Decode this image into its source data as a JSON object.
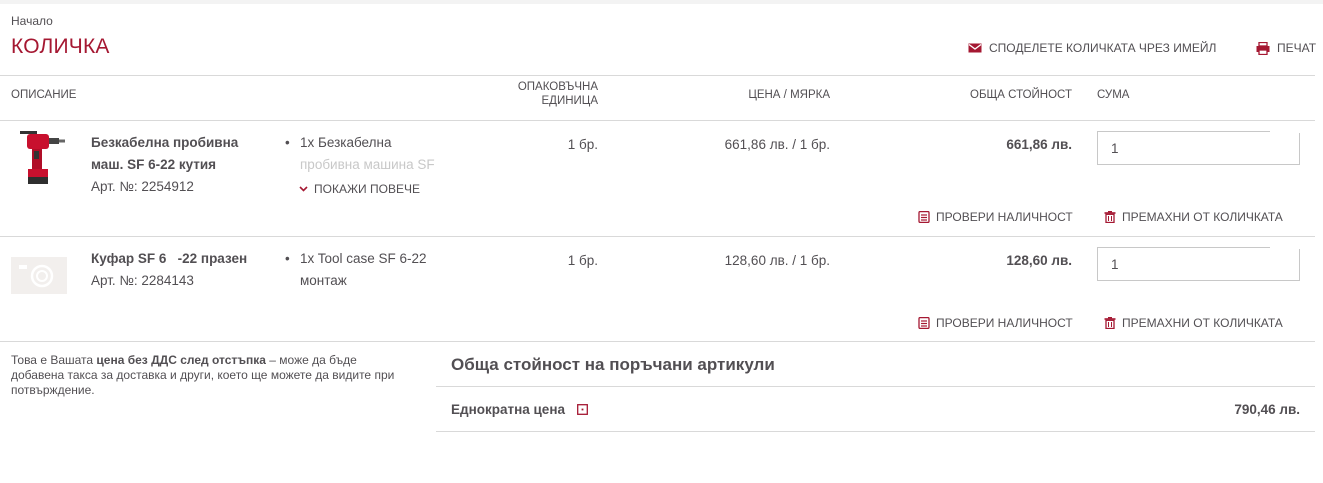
{
  "breadcrumb": "Начало",
  "title": "КОЛИЧКА",
  "actions": {
    "share_email": "СПОДЕЛЕТЕ КОЛИЧКАТА ЧРЕЗ ИМЕЙЛ",
    "print": "ПЕЧАТ"
  },
  "columns": {
    "description": "ОПИСАНИЕ",
    "pack_unit_line1": "ОПАКОВЪЧНА",
    "pack_unit_line2": "ЕДИНИЦА",
    "price_per_unit": "ЦЕНА / МЯРКА",
    "total_value": "ОБЩА СТОЙНОСТ",
    "quantity": "СУМА"
  },
  "items": [
    {
      "name_line1": "Безкабелна пробивна",
      "name_line2": "маш. SF 6-22 кутия",
      "article": "Арт. №: 2254912",
      "desc_line1": "1x Безкабелна",
      "desc_line2": "пробивна машина SF",
      "show_more": "ПОКАЖИ ПОВЕЧЕ",
      "pack_unit": "1 бр.",
      "price": "661,86 лв. / 1 бр.",
      "total": "661,86 лв.",
      "qty": "1",
      "check_availability": "ПРОВЕРИ НАЛИЧНОСТ",
      "remove": "ПРЕМАХНИ ОТ КОЛИЧКАТА"
    },
    {
      "name_line1": "Куфар SF 6   -22 празен",
      "article": "Арт. №: 2284143",
      "desc_line1": "1x Tool case SF 6-22",
      "desc_line2": "монтаж",
      "pack_unit": "1 бр.",
      "price": "128,60 лв. / 1 бр.",
      "total": "128,60 лв.",
      "qty": "1",
      "check_availability": "ПРОВЕРИ НАЛИЧНОСТ",
      "remove": "ПРЕМАХНИ ОТ КОЛИЧКАТА"
    }
  ],
  "note": {
    "prefix": "Това е Вашата ",
    "bold": "цена без ДДС след отстъпка",
    "suffix": " – може да бъде добавена такса за доставка и други, което ще можете да видите при потвърждение."
  },
  "summary": {
    "title": "Обща стойност на поръчани артикули",
    "one_time_label": "Еднократна цена",
    "one_time_value": "790,46 лв."
  },
  "colors": {
    "brand_red": "#a51832",
    "text": "#524f53",
    "divider": "#d9d9d9"
  },
  "icons": {
    "email": "envelope-icon",
    "print": "printer-icon",
    "chevron": "chevron-down-icon",
    "availability": "stock-icon",
    "remove": "trash-icon",
    "info": "info-icon"
  }
}
